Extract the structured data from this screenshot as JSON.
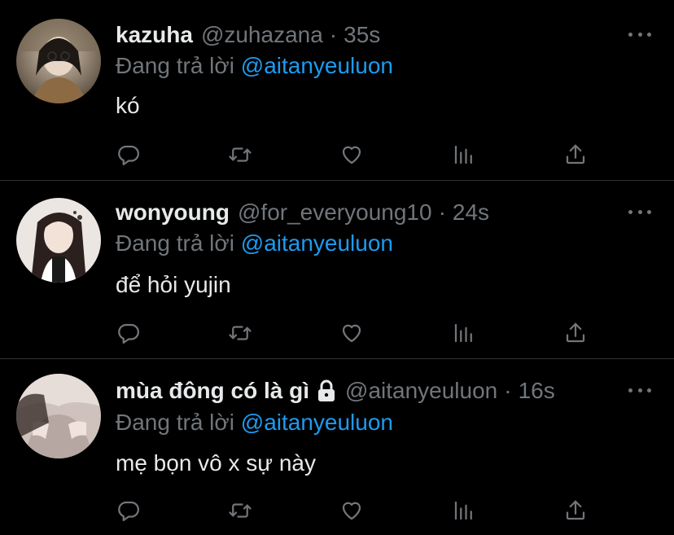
{
  "replies": [
    {
      "name": "kazuha",
      "handle": "@zuhazana",
      "separator": "·",
      "time": "35s",
      "replying_prefix": "Đang trả lời",
      "replying_to": "@aitanyeuluon",
      "text": "kó",
      "avatar_colors": [
        "#6b5a44",
        "#d9c9b4"
      ]
    },
    {
      "name": "wonyoung",
      "handle": "@for_everyoung10",
      "separator": "·",
      "time": "24s",
      "replying_prefix": "Đang trả lời",
      "replying_to": "@aitanyeuluon",
      "text": "để hỏi yujin",
      "avatar_colors": [
        "#e9e3e0",
        "#3a2c2a"
      ]
    },
    {
      "name": "mùa đông có là gì",
      "handle": "@aitanyeuluon",
      "separator": "·",
      "time": "16s",
      "replying_prefix": "Đang trả lời",
      "replying_to": "@aitanyeuluon",
      "text": "mẹ bọn vô x sự này",
      "protected": true,
      "avatar_colors": [
        "#d7c9c4",
        "#8a7a74"
      ]
    }
  ],
  "icons": {
    "reply": "reply-icon",
    "retweet": "retweet-icon",
    "like": "heart-icon",
    "stats": "stats-icon",
    "share": "share-icon",
    "more": "more-icon",
    "lock": "lock-icon"
  },
  "colors": {
    "background": "#000000",
    "text": "#e7e9ea",
    "secondary": "#71767b",
    "accent": "#1d9bf0",
    "divider": "#2f3336"
  }
}
